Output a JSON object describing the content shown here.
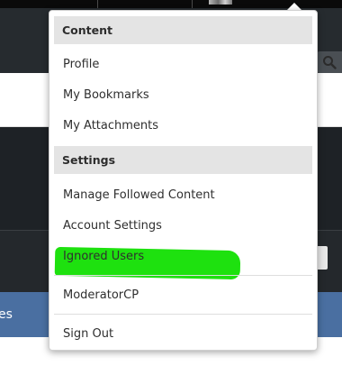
{
  "dropdown": {
    "sections": {
      "content": {
        "header": "Content",
        "items": [
          "Profile",
          "My Bookmarks",
          "My Attachments"
        ]
      },
      "settings": {
        "header": "Settings",
        "items": [
          "Manage Followed Content",
          "Account Settings",
          "Ignored Users"
        ]
      }
    },
    "moderator_label": "ModeratorCP",
    "signout_label": "Sign Out",
    "highlight_color": "#1ee10f"
  },
  "background": {
    "blue_bar_label": "es"
  },
  "icons": {
    "search": "search-icon"
  },
  "colors": {
    "navbar": "#262b2f",
    "panel": "#24282c",
    "blue_bar": "#4a6fa1",
    "section_header": "#e4e4e4"
  }
}
